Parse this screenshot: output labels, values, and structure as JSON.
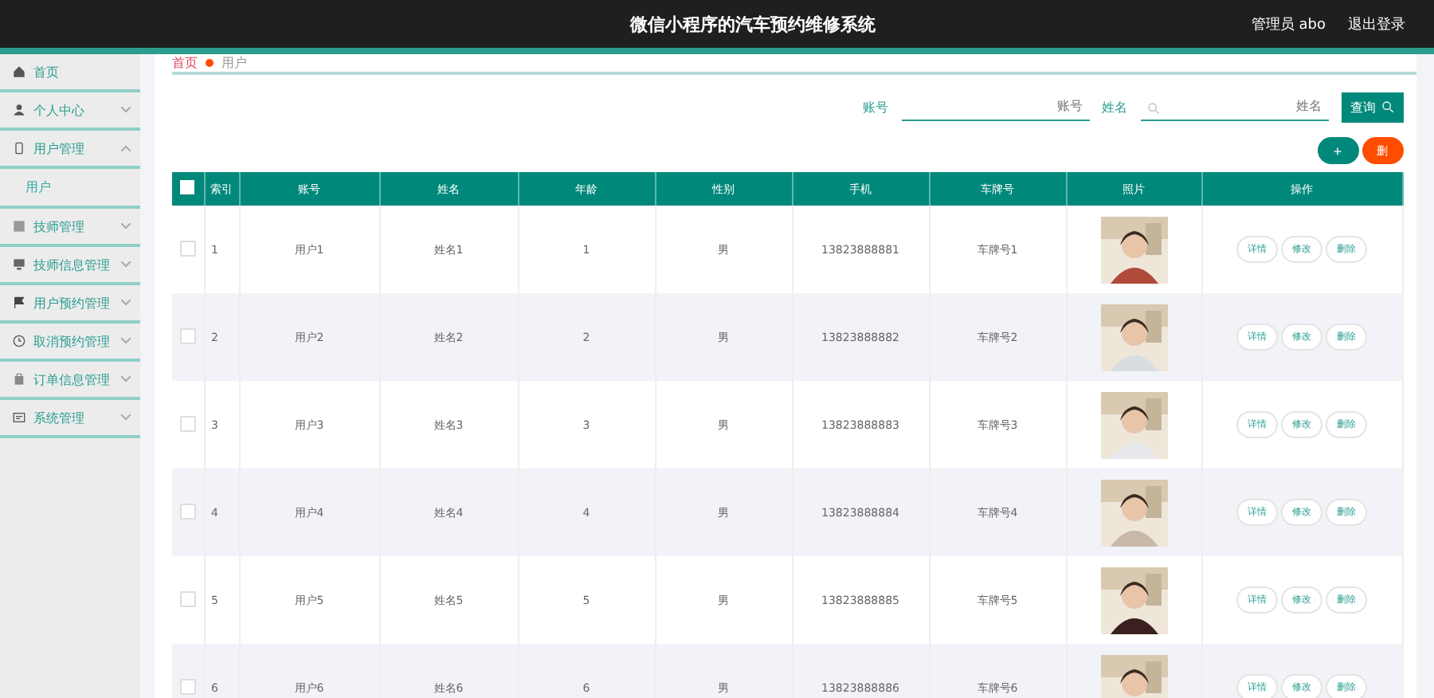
{
  "header": {
    "title": "微信小程序的汽车预约维修系统",
    "user": "管理员 abo",
    "logout": "退出登录"
  },
  "sidebar": {
    "items": [
      {
        "label": "首页",
        "kind": "link"
      },
      {
        "label": "个人中心",
        "kind": "menu",
        "expanded": false
      },
      {
        "label": "用户管理",
        "kind": "menu",
        "expanded": true,
        "children": [
          {
            "label": "用户",
            "selected": true
          }
        ]
      },
      {
        "label": "技师管理",
        "kind": "menu",
        "expanded": false
      },
      {
        "label": "技师信息管理",
        "kind": "menu",
        "expanded": false
      },
      {
        "label": "用户预约管理",
        "kind": "menu",
        "expanded": false
      },
      {
        "label": "取消预约管理",
        "kind": "menu",
        "expanded": false
      },
      {
        "label": "订单信息管理",
        "kind": "menu",
        "expanded": false
      },
      {
        "label": "系统管理",
        "kind": "menu",
        "expanded": false
      }
    ]
  },
  "breadcrumb": [
    "首页",
    "用户"
  ],
  "search": {
    "fields": [
      {
        "label": "账号",
        "placeholder": "账号"
      },
      {
        "label": "姓名",
        "placeholder": "姓名"
      }
    ],
    "button": "查询"
  },
  "actions": {
    "add": "+",
    "delete": "删"
  },
  "table": {
    "all_checked": false,
    "columns": [
      "索引",
      "账号",
      "姓名",
      "年龄",
      "性别",
      "手机",
      "车牌号",
      "照片",
      "操作"
    ],
    "rows": [
      {
        "checked": false,
        "cells": [
          "1",
          "用户1",
          "姓名1",
          "1",
          "男",
          "13823888881",
          "车牌号1"
        ],
        "actions": [
          "详情",
          "修改",
          "删除"
        ]
      },
      {
        "checked": false,
        "cells": [
          "2",
          "用户2",
          "姓名2",
          "2",
          "男",
          "13823888882",
          "车牌号2"
        ],
        "actions": [
          "详情",
          "修改",
          "删除"
        ]
      },
      {
        "checked": false,
        "cells": [
          "3",
          "用户3",
          "姓名3",
          "3",
          "男",
          "13823888883",
          "车牌号3"
        ],
        "actions": [
          "详情",
          "修改",
          "删除"
        ]
      },
      {
        "checked": false,
        "cells": [
          "4",
          "用户4",
          "姓名4",
          "4",
          "男",
          "13823888884",
          "车牌号4"
        ],
        "actions": [
          "详情",
          "修改",
          "删除"
        ]
      },
      {
        "checked": false,
        "cells": [
          "5",
          "用户5",
          "姓名5",
          "5",
          "男",
          "13823888885",
          "车牌号5"
        ],
        "actions": [
          "详情",
          "修改",
          "删除"
        ]
      },
      {
        "checked": false,
        "cells": [
          "6",
          "用户6",
          "姓名6",
          "6",
          "男",
          "13823888886",
          "车牌号6"
        ],
        "actions": [
          "详情",
          "修改",
          "删除"
        ]
      }
    ]
  }
}
